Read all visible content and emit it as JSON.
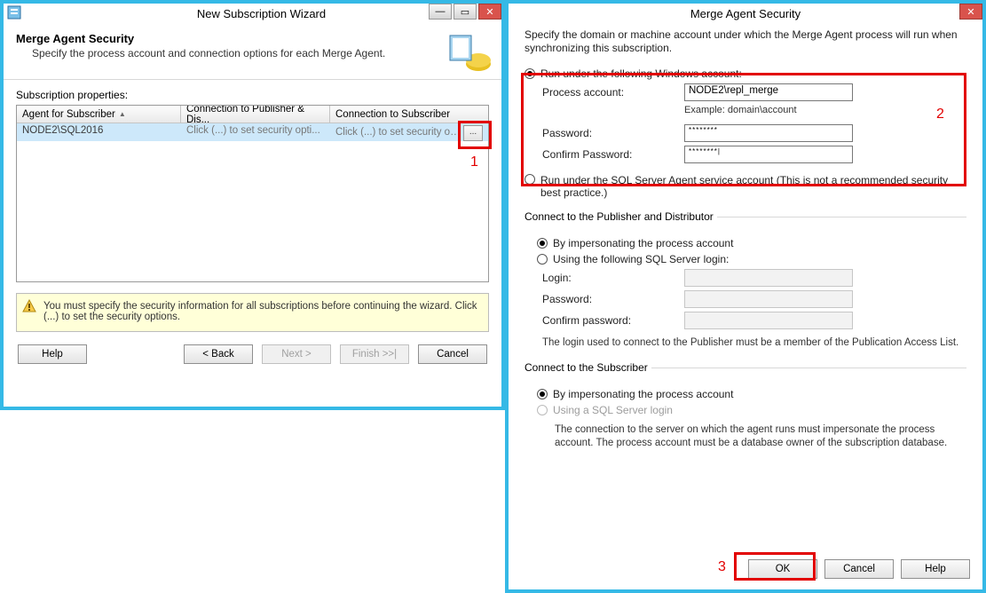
{
  "wizard": {
    "title": "New Subscription Wizard",
    "page_title": "Merge Agent Security",
    "page_sub": "Specify the process account and connection options for each Merge Agent.",
    "prop_label": "Subscription properties:",
    "columns": {
      "c1": "Agent for Subscriber",
      "c2": "Connection to Publisher & Dis...",
      "c3": "Connection to Subscriber"
    },
    "row": {
      "c1": "NODE2\\SQL2016",
      "c2": "Click (...) to set security opti...",
      "c3": "Click (...) to set security opti..."
    },
    "ellipsis": "...",
    "warning": "You must specify the security information for all subscriptions before continuing the wizard. Click (...) to set the security options.",
    "buttons": {
      "help": "Help",
      "back": "< Back",
      "next": "Next >",
      "finish": "Finish >>|",
      "cancel": "Cancel"
    }
  },
  "security": {
    "title": "Merge Agent Security",
    "desc": "Specify the domain or machine account under which the Merge Agent process will run when synchronizing this subscription.",
    "opt_win": "Run under the following Windows account:",
    "process_account_lbl": "Process account:",
    "process_account_val": "NODE2\\repl_merge",
    "example": "Example: domain\\account",
    "password_lbl": "Password:",
    "password_val": "********",
    "confirm_lbl": "Confirm Password:",
    "confirm_val": "********|",
    "opt_sa": "Run under the SQL Server Agent service account (This is not a recommended security best practice.)",
    "pub_legend": "Connect to the Publisher and Distributor",
    "pub_opt1": "By impersonating the process account",
    "pub_opt2": "Using the following SQL Server login:",
    "login_lbl": "Login:",
    "pwd_lbl": "Password:",
    "cpwd_lbl": "Confirm password:",
    "pub_note": "The login used to connect to the Publisher must be a member of the Publication Access List.",
    "sub_legend": "Connect to the Subscriber",
    "sub_opt1": "By impersonating the process account",
    "sub_opt2": "Using a SQL Server login",
    "sub_note": "The connection to the server on which the agent runs must impersonate the process account. The process account must be a database owner of the subscription database.",
    "ok": "OK",
    "cancel": "Cancel",
    "help": "Help"
  },
  "callouts": {
    "n1": "1",
    "n2": "2",
    "n3": "3"
  }
}
